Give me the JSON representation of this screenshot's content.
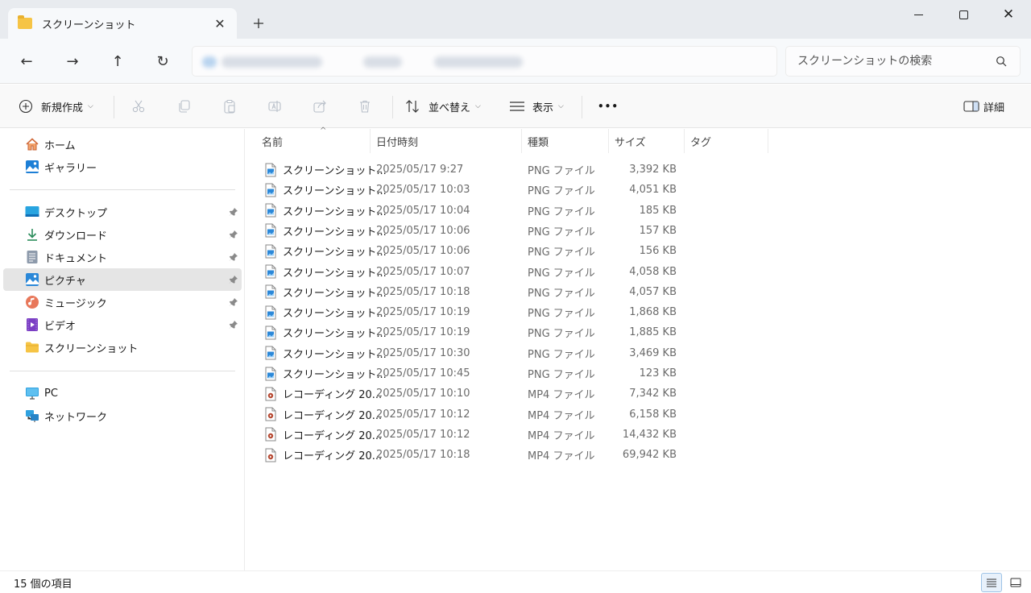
{
  "tab": {
    "title": "スクリーンショット"
  },
  "window": {
    "close_glyph": "✕"
  },
  "nav": {
    "back": "←",
    "forward": "→",
    "up": "↑",
    "refresh": "↻"
  },
  "search": {
    "placeholder": "スクリーンショットの検索"
  },
  "toolbar": {
    "new_label": "新規作成",
    "sort_label": "並べ替え",
    "view_label": "表示",
    "more_label": "•••",
    "details_label": "詳細"
  },
  "sidebar": {
    "home": "ホーム",
    "gallery": "ギャラリー",
    "desktop": "デスクトップ",
    "downloads": "ダウンロード",
    "documents": "ドキュメント",
    "pictures": "ピクチャ",
    "music": "ミュージック",
    "videos": "ビデオ",
    "screenshots": "スクリーンショット",
    "pc": "PC",
    "network": "ネットワーク"
  },
  "columns": {
    "name": "名前",
    "date": "日付時刻",
    "type": "種類",
    "size": "サイズ",
    "tag": "タグ"
  },
  "files": [
    {
      "name": "スクリーンショット...",
      "date": "2025/05/17 9:27",
      "type": "PNG ファイル",
      "size": "3,392 KB",
      "kind": "image"
    },
    {
      "name": "スクリーンショット...",
      "date": "2025/05/17 10:03",
      "type": "PNG ファイル",
      "size": "4,051 KB",
      "kind": "image"
    },
    {
      "name": "スクリーンショット...",
      "date": "2025/05/17 10:04",
      "type": "PNG ファイル",
      "size": "185 KB",
      "kind": "image"
    },
    {
      "name": "スクリーンショット...",
      "date": "2025/05/17 10:06",
      "type": "PNG ファイル",
      "size": "157 KB",
      "kind": "image"
    },
    {
      "name": "スクリーンショット...",
      "date": "2025/05/17 10:06",
      "type": "PNG ファイル",
      "size": "156 KB",
      "kind": "image"
    },
    {
      "name": "スクリーンショット...",
      "date": "2025/05/17 10:07",
      "type": "PNG ファイル",
      "size": "4,058 KB",
      "kind": "image"
    },
    {
      "name": "スクリーンショット...",
      "date": "2025/05/17 10:18",
      "type": "PNG ファイル",
      "size": "4,057 KB",
      "kind": "image"
    },
    {
      "name": "スクリーンショット...",
      "date": "2025/05/17 10:19",
      "type": "PNG ファイル",
      "size": "1,868 KB",
      "kind": "image"
    },
    {
      "name": "スクリーンショット...",
      "date": "2025/05/17 10:19",
      "type": "PNG ファイル",
      "size": "1,885 KB",
      "kind": "image"
    },
    {
      "name": "スクリーンショット...",
      "date": "2025/05/17 10:30",
      "type": "PNG ファイル",
      "size": "3,469 KB",
      "kind": "image"
    },
    {
      "name": "スクリーンショット...",
      "date": "2025/05/17 10:45",
      "type": "PNG ファイル",
      "size": "123 KB",
      "kind": "image"
    },
    {
      "name": "レコーディング 20...",
      "date": "2025/05/17 10:10",
      "type": "MP4 ファイル",
      "size": "7,342 KB",
      "kind": "video"
    },
    {
      "name": "レコーディング 20...",
      "date": "2025/05/17 10:12",
      "type": "MP4 ファイル",
      "size": "6,158 KB",
      "kind": "video"
    },
    {
      "name": "レコーディング 20...",
      "date": "2025/05/17 10:12",
      "type": "MP4 ファイル",
      "size": "14,432 KB",
      "kind": "video"
    },
    {
      "name": "レコーディング 20...",
      "date": "2025/05/17 10:18",
      "type": "MP4 ファイル",
      "size": "69,942 KB",
      "kind": "video"
    }
  ],
  "status": {
    "count": "15 個の項目"
  },
  "colors": {
    "accent": "#0067c0",
    "folder": "#f6c445",
    "selected": "#e5e5e5",
    "titlebar": "#e8ebef"
  }
}
